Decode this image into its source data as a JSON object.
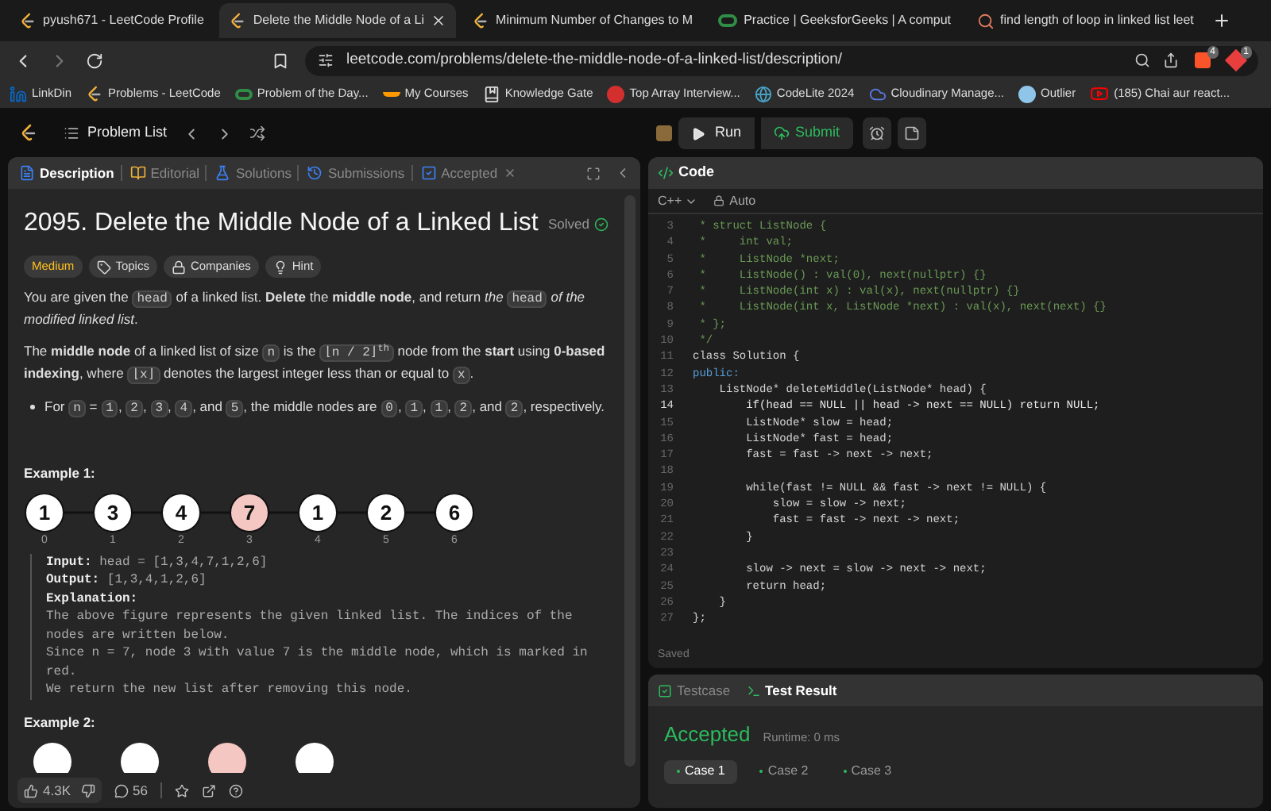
{
  "browser": {
    "tabs": [
      {
        "title": "pyush671 - LeetCode Profile",
        "selected": false,
        "kind": "leetcode"
      },
      {
        "title": "Delete the Middle Node of a Li",
        "selected": true,
        "kind": "leetcode"
      },
      {
        "title": "Minimum Number of Changes to M",
        "selected": false,
        "kind": "leetcode"
      },
      {
        "title": "Practice | GeeksforGeeks | A comput",
        "selected": false,
        "kind": "gfg"
      },
      {
        "title": "find length of loop in linked list leet",
        "selected": false,
        "kind": "search"
      }
    ],
    "address": "leetcode.com/problems/delete-the-middle-node-of-a-linked-list/description/",
    "extension_badges": [
      "4",
      "1"
    ],
    "bookmarks": [
      {
        "label": "LinkDin",
        "kind": "linkedin"
      },
      {
        "label": "Problems - LeetCode",
        "kind": "leetcode"
      },
      {
        "label": "Problem of the Day...",
        "kind": "gfg"
      },
      {
        "label": "My Courses",
        "kind": "courses"
      },
      {
        "label": "Knowledge Gate",
        "kind": "gate"
      },
      {
        "label": "Top Array Interview...",
        "kind": "tuf"
      },
      {
        "label": "CodeLite 2024",
        "kind": "globe"
      },
      {
        "label": "Cloudinary Manage...",
        "kind": "cloud"
      },
      {
        "label": "Outlier",
        "kind": "outlier"
      },
      {
        "label": "(185) Chai aur react...",
        "kind": "youtube"
      }
    ]
  },
  "nav": {
    "problem_list": "Problem List"
  },
  "description_panel": {
    "tabs": [
      {
        "label": "Description",
        "selected": true,
        "kind": "description"
      },
      {
        "label": "Editorial",
        "selected": false,
        "kind": "editorial"
      },
      {
        "label": "Solutions",
        "selected": false,
        "kind": "solutions"
      },
      {
        "label": "Submissions",
        "selected": false,
        "kind": "submissions"
      },
      {
        "label": "Accepted",
        "selected": false,
        "kind": "accepted"
      }
    ],
    "title": "2095. Delete the Middle Node of a Linked List",
    "status": "Solved",
    "tags": [
      {
        "label": "Medium",
        "kind": "difficulty"
      },
      {
        "label": "Topics",
        "kind": "topics"
      },
      {
        "label": "Companies",
        "kind": "companies"
      },
      {
        "label": "Hint",
        "kind": "hint"
      }
    ],
    "paragraphs": [
      [
        {
          "kind": "text",
          "text": "You are given the "
        },
        {
          "kind": "code",
          "text": "head"
        },
        {
          "kind": "text",
          "text": " of a linked list. **Delete** the **middle node**, and return *the* "
        },
        {
          "kind": "code",
          "text": "head"
        },
        {
          "kind": "text",
          "text": " *of the modified linked list*."
        }
      ],
      [
        {
          "kind": "text",
          "text": "The **middle node** of a linked list of size "
        },
        {
          "kind": "code",
          "text": "n"
        },
        {
          "kind": "text",
          "text": " is the "
        },
        {
          "kind": "code",
          "text": "⌊n / 2⌋$^{th}$"
        },
        {
          "kind": "text",
          "text": " node from the **start** using **0-based indexing**, where "
        },
        {
          "kind": "code",
          "text": "⌊x⌋"
        },
        {
          "kind": "text",
          "text": " denotes the largest integer less than or equal to "
        },
        {
          "kind": "code",
          "text": "x"
        },
        {
          "kind": "text",
          "text": "."
        }
      ]
    ],
    "bullets": [
      [
        {
          "kind": "text",
          "text": "For "
        },
        {
          "kind": "code",
          "text": "n"
        },
        {
          "kind": "text",
          "text": " = "
        },
        {
          "kind": "code",
          "text": "1"
        },
        {
          "kind": "text",
          "text": ", "
        },
        {
          "kind": "code",
          "text": "2"
        },
        {
          "kind": "text",
          "text": ", "
        },
        {
          "kind": "code",
          "text": "3"
        },
        {
          "kind": "text",
          "text": ", "
        },
        {
          "kind": "code",
          "text": "4"
        },
        {
          "kind": "text",
          "text": ", and "
        },
        {
          "kind": "code",
          "text": "5"
        },
        {
          "kind": "text",
          "text": ", the middle nodes are "
        },
        {
          "kind": "code",
          "text": "0"
        },
        {
          "kind": "text",
          "text": ", "
        },
        {
          "kind": "code",
          "text": "1"
        },
        {
          "kind": "text",
          "text": ", "
        },
        {
          "kind": "code",
          "text": "1"
        },
        {
          "kind": "text",
          "text": ", "
        },
        {
          "kind": "code",
          "text": "2"
        },
        {
          "kind": "text",
          "text": ", and "
        },
        {
          "kind": "code",
          "text": "2"
        },
        {
          "kind": "text",
          "text": ", respectively."
        }
      ]
    ],
    "example_1": {
      "title": "Example 1:",
      "nodes": [
        {
          "value": "1",
          "index": "0",
          "highlighted": false
        },
        {
          "value": "3",
          "index": "1",
          "highlighted": false
        },
        {
          "value": "4",
          "index": "2",
          "highlighted": false
        },
        {
          "value": "7",
          "index": "3",
          "highlighted": true
        },
        {
          "value": "1",
          "index": "4",
          "highlighted": false
        },
        {
          "value": "2",
          "index": "5",
          "highlighted": false
        },
        {
          "value": "6",
          "index": "6",
          "highlighted": false
        }
      ],
      "lines": [
        {
          "label": "Input:",
          "text": "head = [1,3,4,7,1,2,6]"
        },
        {
          "label": "Output:",
          "text": "[1,3,4,1,2,6]"
        },
        {
          "label": "Explanation:"
        }
      ],
      "explanation": "The above figure represents the given linked list. The indices of the nodes are written below.\nSince n = 7, node 3 with value 7 is the middle node, which is marked in red.\nWe return the new list after removing this node."
    },
    "example_2": {
      "title": "Example 2:",
      "nodes": [
        {
          "highlighted": false
        },
        {
          "highlighted": false
        },
        {
          "highlighted": true
        },
        {
          "highlighted": false
        }
      ]
    },
    "footer": {
      "likes": "4.3K",
      "comments": "56"
    }
  },
  "toolbar": {
    "run": "Run",
    "submit": "Submit"
  },
  "code_panel": {
    "title": "Code",
    "language": "C++",
    "mode": "Auto",
    "status": "Saved",
    "lines": [
      {
        "no": "3",
        "text": " * struct ListNode {",
        "kind": "comment"
      },
      {
        "no": "4",
        "text": " *     int val;",
        "kind": "comment"
      },
      {
        "no": "5",
        "text": " *     ListNode *next;",
        "kind": "comment"
      },
      {
        "no": "6",
        "text": " *     ListNode() : val(0), next(nullptr) {}",
        "kind": "comment"
      },
      {
        "no": "7",
        "text": " *     ListNode(int x) : val(x), next(nullptr) {}",
        "kind": "comment"
      },
      {
        "no": "8",
        "text": " *     ListNode(int x, ListNode *next) : val(x), next(next) {}",
        "kind": "comment"
      },
      {
        "no": "9",
        "text": " * };",
        "kind": "comment"
      },
      {
        "no": "10",
        "text": " */",
        "kind": "comment"
      },
      {
        "no": "11",
        "text": "class Solution {",
        "kind": "code"
      },
      {
        "no": "12",
        "text": "public:",
        "kind": "keyword"
      },
      {
        "no": "13",
        "text": "    ListNode* deleteMiddle(ListNode* head) {",
        "kind": "code"
      },
      {
        "no": "14",
        "text": "        if(head == NULL || head -> next == NULL) return NULL;",
        "kind": "current"
      },
      {
        "no": "15",
        "text": "        ListNode* slow = head;",
        "kind": "code"
      },
      {
        "no": "16",
        "text": "        ListNode* fast = head;",
        "kind": "code"
      },
      {
        "no": "17",
        "text": "        fast = fast -> next -> next;",
        "kind": "code"
      },
      {
        "no": "18",
        "kind": "code"
      },
      {
        "no": "19",
        "text": "        while(fast != NULL && fast -> next != NULL) {",
        "kind": "code"
      },
      {
        "no": "20",
        "text": "            slow = slow -> next;",
        "kind": "code"
      },
      {
        "no": "21",
        "text": "            fast = fast -> next -> next;",
        "kind": "code"
      },
      {
        "no": "22",
        "text": "        }",
        "kind": "code"
      },
      {
        "no": "23",
        "kind": "code"
      },
      {
        "no": "24",
        "text": "        slow -> next = slow -> next -> next;",
        "kind": "code"
      },
      {
        "no": "25",
        "text": "        return head;",
        "kind": "code"
      },
      {
        "no": "26",
        "text": "    }",
        "kind": "code"
      },
      {
        "no": "27",
        "text": "};",
        "kind": "code"
      }
    ]
  },
  "result_panel": {
    "tabs": [
      {
        "label": "Testcase",
        "selected": false
      },
      {
        "label": "Test Result",
        "selected": true
      }
    ],
    "verdict": "Accepted",
    "runtime": "Runtime: 0 ms",
    "cases": [
      {
        "label": "Case 1",
        "selected": true
      },
      {
        "label": "Case 2",
        "selected": false
      },
      {
        "label": "Case 3",
        "selected": false
      }
    ]
  }
}
